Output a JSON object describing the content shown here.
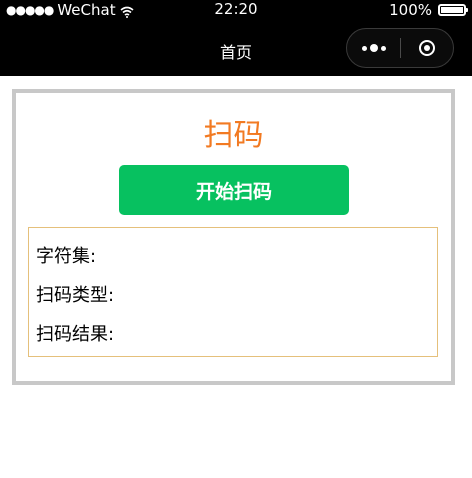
{
  "status_bar": {
    "signal": "●●●●●",
    "carrier": "WeChat",
    "time": "22:20",
    "battery_percent": "100%",
    "battery_level": 1.0
  },
  "nav": {
    "title": "首页"
  },
  "page": {
    "title": "扫码",
    "scan_button_label": "开始扫码",
    "fields": {
      "charset_label": "字符集:",
      "scan_type_label": "扫码类型:",
      "scan_result_label": "扫码结果:"
    }
  },
  "colors": {
    "title": "#f27a22",
    "button": "#07c160",
    "panel_border": "#c8c8c8",
    "result_border": "#e5c07b"
  }
}
